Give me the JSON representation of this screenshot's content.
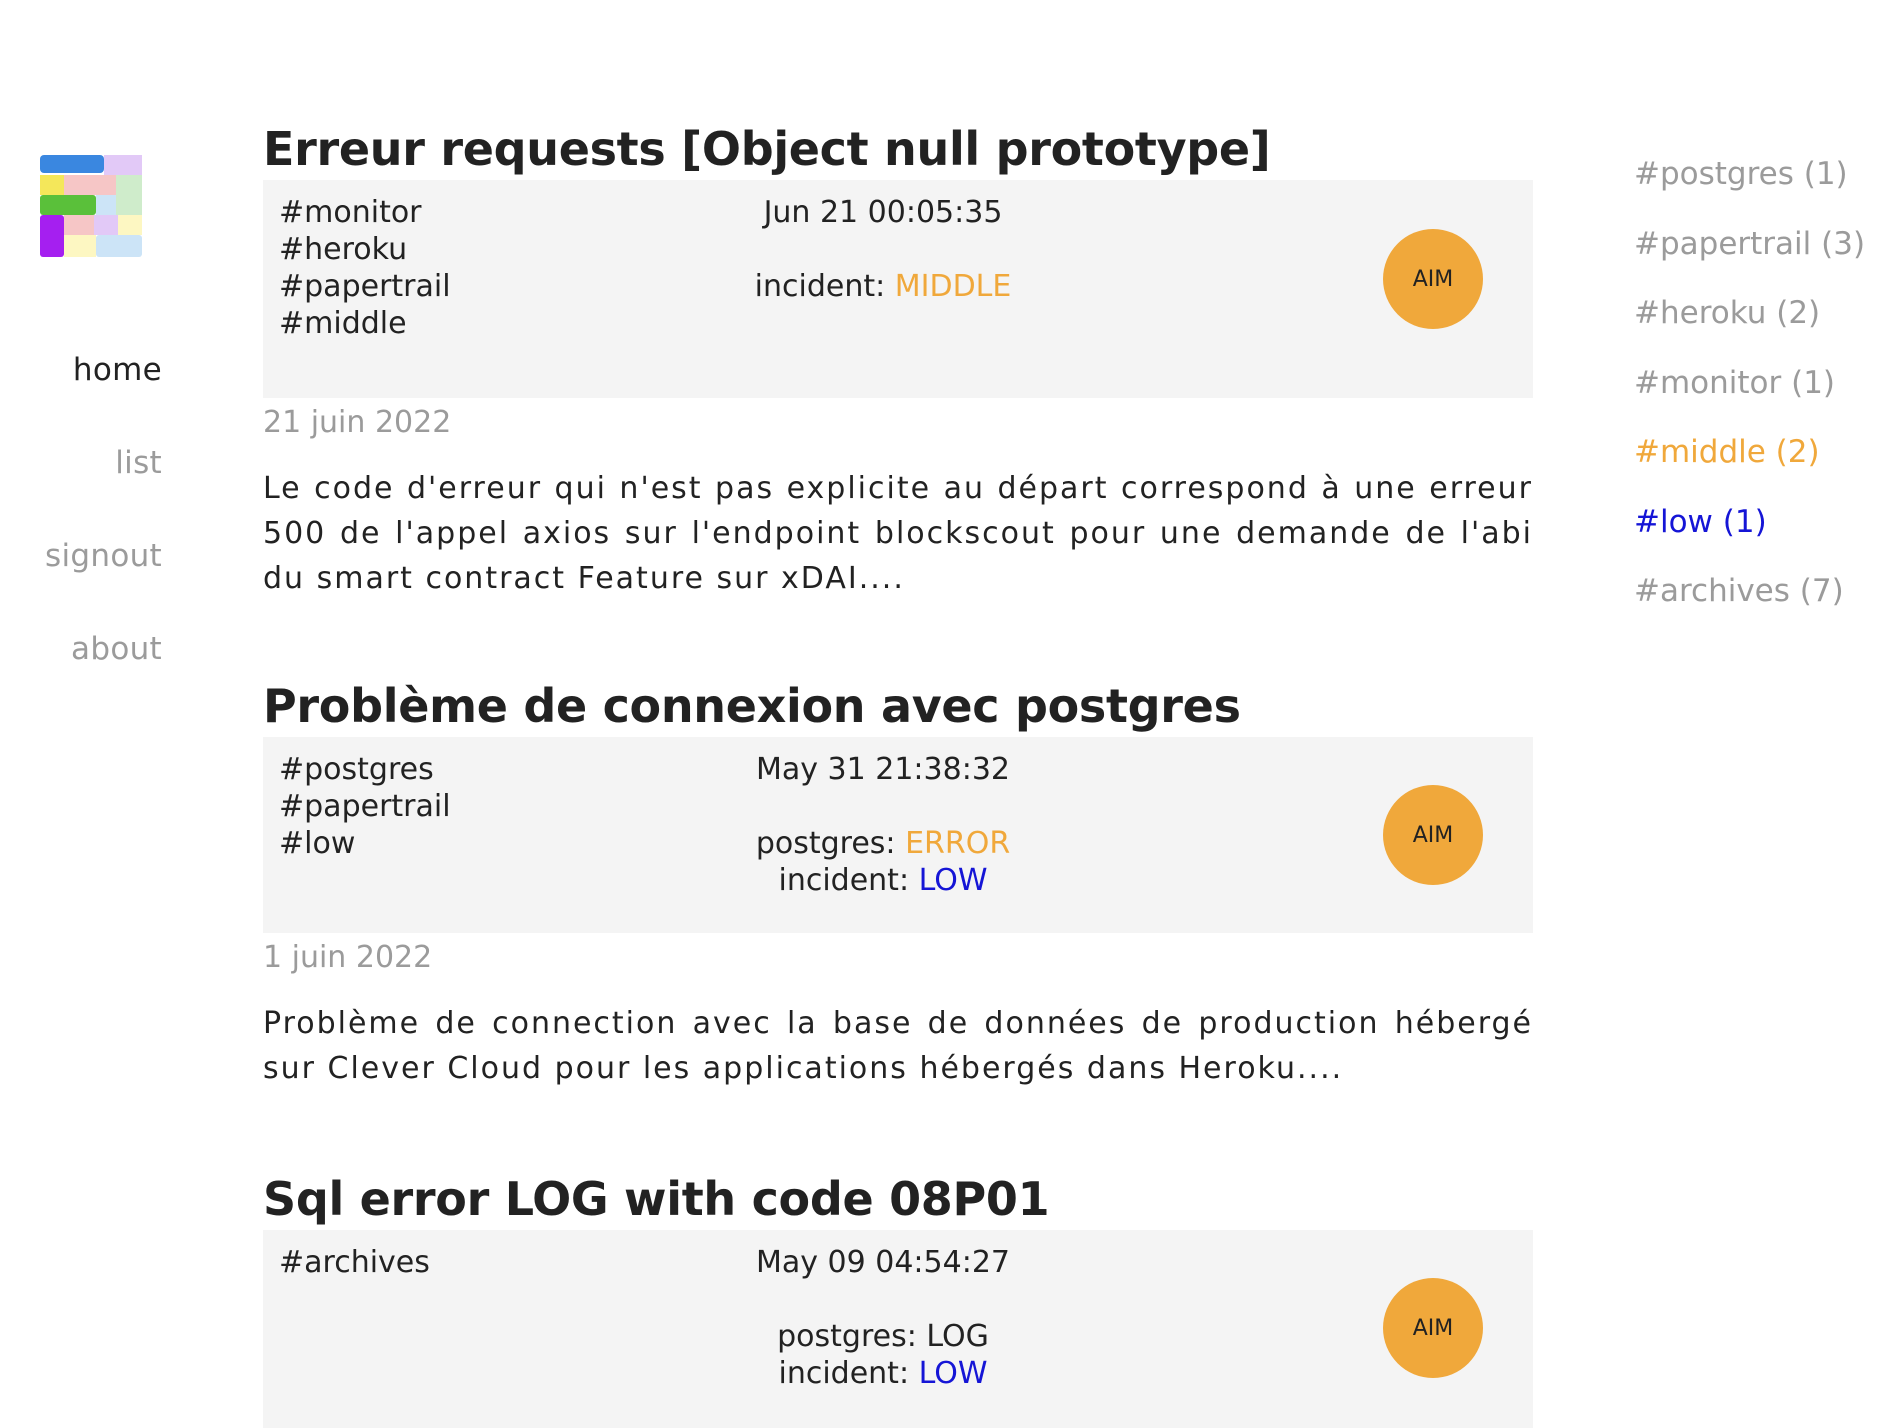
{
  "nav": {
    "items": [
      {
        "label": "home",
        "active": true
      },
      {
        "label": "list",
        "active": false
      },
      {
        "label": "signout",
        "active": false
      },
      {
        "label": "about",
        "active": false
      }
    ]
  },
  "posts": [
    {
      "title": "Erreur requests [Object null prototype]",
      "tags": [
        "#monitor",
        "#heroku",
        "#papertrail",
        "#middle"
      ],
      "timestamp": "Jun 21 00:05:35",
      "status": [
        {
          "key": "incident: ",
          "value": "MIDDLE",
          "color": "#f0a83b"
        }
      ],
      "avatar": "AIM",
      "date": "21 juin 2022",
      "excerpt": "Le code d'erreur qui n'est pas explicite au départ correspond à une erreur 500 de l'appel axios sur l'endpoint blockscout pour une demande de l'abi du smart contract Feature sur xDAI...."
    },
    {
      "title": "Problème de connexion avec postgres",
      "tags": [
        "#postgres",
        "#papertrail",
        "#low"
      ],
      "timestamp": "May 31 21:38:32",
      "status": [
        {
          "key": "postgres: ",
          "value": "ERROR",
          "color": "#f0a83b"
        },
        {
          "key": "incident: ",
          "value": "LOW",
          "color": "#1515d6"
        }
      ],
      "avatar": "AIM",
      "date": "1 juin 2022",
      "excerpt": "Problème de connection avec la base de données de production hébergé sur Clever Cloud pour les applications hébergés dans Heroku...."
    },
    {
      "title": "Sql error LOG with code 08P01",
      "tags": [
        "#archives"
      ],
      "timestamp": "May 09 04:54:27",
      "status": [
        {
          "key": "postgres: ",
          "value": "LOG",
          "color": "#222222"
        },
        {
          "key": "incident: ",
          "value": "LOW",
          "color": "#1515d6"
        }
      ],
      "avatar": "AIM",
      "date": "",
      "excerpt": ""
    }
  ],
  "tag_cloud": [
    {
      "label": "#postgres (1)",
      "color": "#9b9b9b"
    },
    {
      "label": "#papertrail (3)",
      "color": "#9b9b9b"
    },
    {
      "label": "#heroku (2)",
      "color": "#9b9b9b"
    },
    {
      "label": "#monitor (1)",
      "color": "#9b9b9b"
    },
    {
      "label": "#middle (2)",
      "color": "#f0a83b"
    },
    {
      "label": "#low (1)",
      "color": "#1515d6"
    },
    {
      "label": "#archives (7)",
      "color": "#9b9b9b"
    }
  ]
}
